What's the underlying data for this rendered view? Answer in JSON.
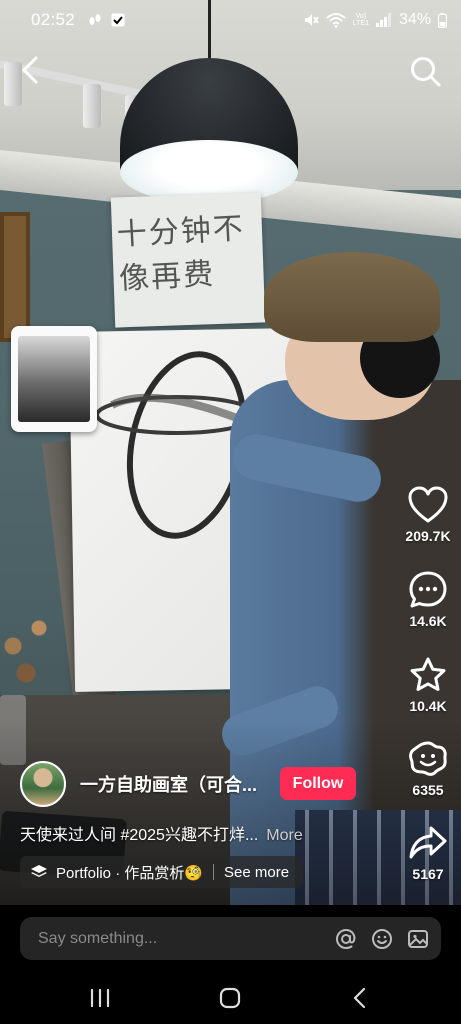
{
  "status_bar": {
    "time": "02:52",
    "net_label_top": "Vo)",
    "net_label_bottom": "LTE1",
    "battery": "34%"
  },
  "video": {
    "poster_text": "十分钟不像再费"
  },
  "actions": {
    "likes": "209.7K",
    "comments": "14.6K",
    "favorites": "10.4K",
    "shares_secondary": "6355",
    "shares": "5167"
  },
  "author": {
    "name": "一方自助画室（可合...",
    "follow_label": "Follow"
  },
  "caption": {
    "text": "天使来过人间 #2025兴趣不打烊...",
    "more_label": "More"
  },
  "collection": {
    "label": "Portfolio · 作品赏析🧐",
    "see_more": "See more"
  },
  "comment": {
    "placeholder": "Say something..."
  },
  "colors": {
    "follow_button": "#fe2c55",
    "comment_box": "#252525"
  }
}
